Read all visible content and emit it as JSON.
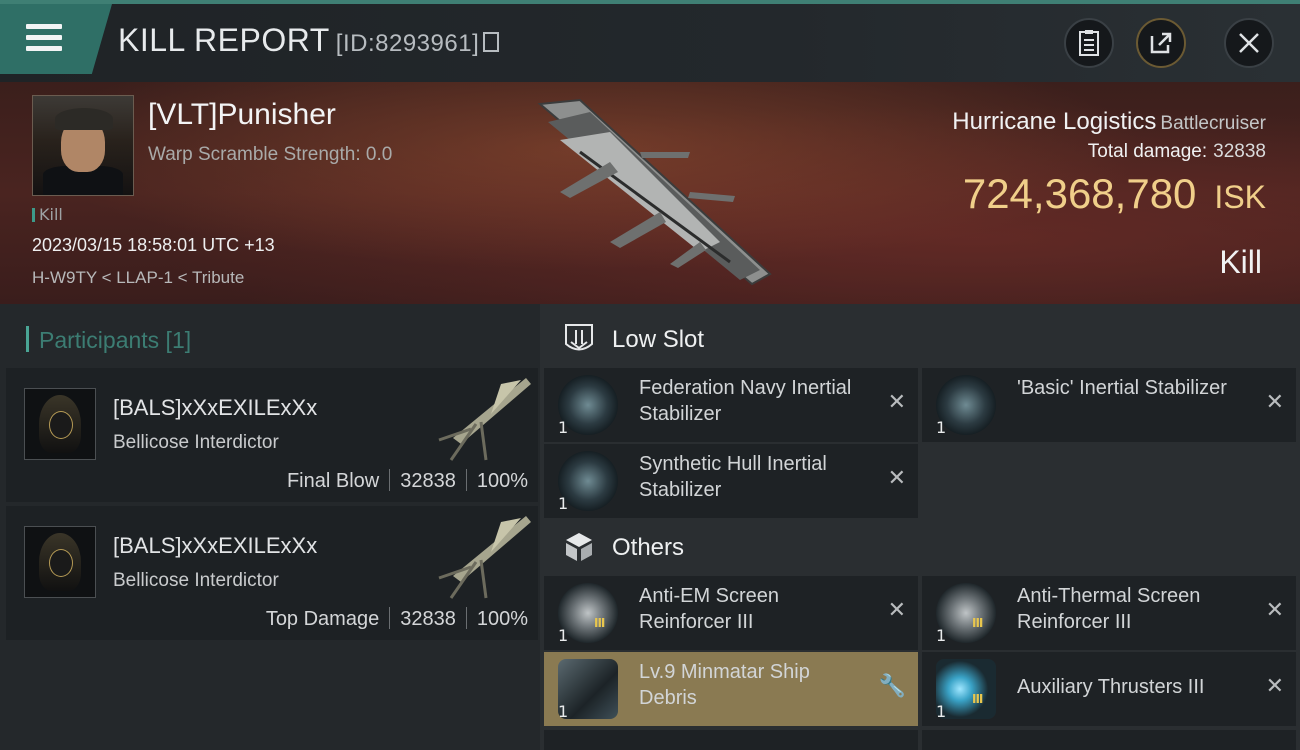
{
  "header": {
    "title": "KILL REPORT",
    "report_id": "[ID:8293961]",
    "buttons": {
      "notes_icon": "clipboard-icon",
      "share_icon": "share-icon",
      "close_icon": "close-icon"
    }
  },
  "victim": {
    "name": "[VLT]Punisher",
    "warp_scramble": "Warp Scramble Strength: 0.0",
    "tag": "Kill",
    "timestamp": "2023/03/15 18:58:01 UTC +13",
    "location": "H-W9TY < LLAP-1 < Tribute"
  },
  "ship": {
    "name": "Hurricane Logistics",
    "class": "Battlecruiser",
    "total_damage_label": "Total damage:",
    "total_damage": "32838",
    "isk_value": "724,368,780",
    "isk_unit": "ISK",
    "result": "Kill"
  },
  "participants": {
    "header": "Participants [1]",
    "items": [
      {
        "name": "[BALS]xXxEXILExXx",
        "ship": "Bellicose Interdictor",
        "role": "Final Blow",
        "damage": "32838",
        "percent": "100%"
      },
      {
        "name": "[BALS]xXxEXILExXx",
        "ship": "Bellicose Interdictor",
        "role": "Top Damage",
        "damage": "32838",
        "percent": "100%"
      }
    ]
  },
  "low_slot": {
    "title": "Low Slot",
    "items": [
      {
        "name": "Federation Navy Inertial Stabilizer",
        "qty": "1",
        "status": "destroyed"
      },
      {
        "name": "'Basic' Inertial Stabilizer",
        "qty": "1",
        "status": "destroyed"
      },
      {
        "name": "Synthetic Hull Inertial Stabilizer",
        "qty": "1",
        "status": "destroyed"
      }
    ]
  },
  "others": {
    "title": "Others",
    "items": [
      {
        "name": "Anti-EM Screen Reinforcer III",
        "qty": "1",
        "status": "destroyed"
      },
      {
        "name": "Anti-Thermal Screen Reinforcer III",
        "qty": "1",
        "status": "destroyed"
      },
      {
        "name": "Lv.9 Minmatar Ship Debris",
        "qty": "1",
        "status": "dropped"
      },
      {
        "name": "Auxiliary Thrusters III",
        "qty": "1",
        "status": "destroyed"
      }
    ]
  },
  "glyphs": {
    "destroyed": "✕",
    "dropped": "🔧"
  },
  "colors": {
    "accent": "#3f7f74",
    "isk": "#f0cf8a",
    "highlight": "#8a7a52"
  }
}
